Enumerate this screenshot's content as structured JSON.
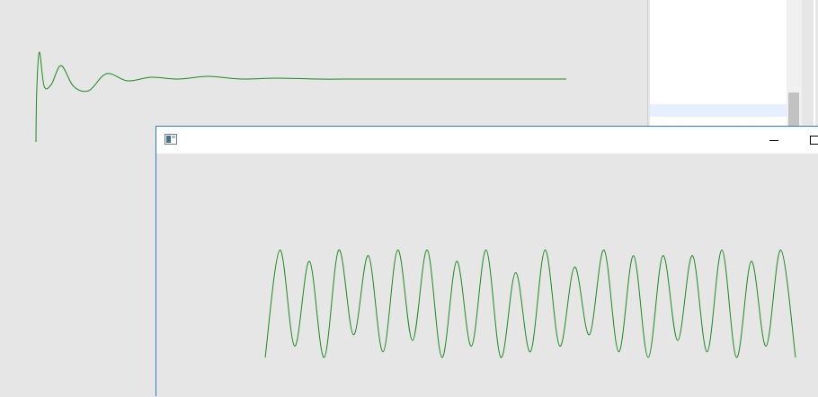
{
  "colors": {
    "signal": "#1a8a1a",
    "window_border": "#2b78d6",
    "background": "#e6e6e6",
    "titlebar": "#ffffff"
  },
  "icons": {
    "app": "app-window-icon",
    "minimize": "minimize-icon",
    "maximize": "maximize-icon"
  },
  "chart_data": [
    {
      "type": "line",
      "description_units": "arbitrary",
      "series": [
        {
          "values": [
            0.0,
            0.55,
            1.0,
            0.62,
            0.64,
            0.85,
            0.62,
            0.57,
            0.76,
            0.68,
            0.72,
            0.7,
            0.73,
            0.7,
            0.71,
            0.7,
            0.7,
            0.7,
            0.7,
            0.7,
            0.7
          ]
        }
      ]
    },
    {
      "type": "line",
      "description_units": "arbitrary",
      "series": [
        {
          "values": [
            0.0,
            0.95,
            0.1,
            0.85,
            0.0,
            0.95,
            0.2,
            0.9,
            0.05,
            0.95,
            0.15,
            0.95,
            0.0,
            0.85,
            0.1,
            0.95,
            0.0,
            0.75,
            0.05,
            0.95,
            0.1,
            0.8,
            0.2,
            0.95,
            0.05,
            0.9,
            0.0,
            0.9,
            0.15,
            0.9,
            0.05,
            0.95,
            0.0,
            0.85,
            0.1,
            0.95,
            0.0
          ]
        }
      ]
    }
  ]
}
